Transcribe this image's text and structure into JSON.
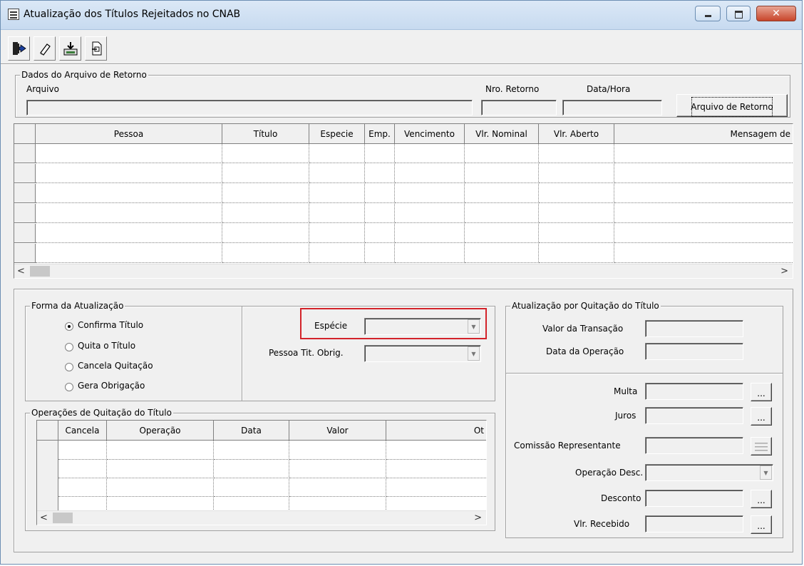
{
  "window": {
    "title": "Atualização dos Títulos Rejeitados no CNAB",
    "close_glyph": "✕"
  },
  "toolbar": {
    "exit_icon": "exit-icon",
    "eraser_icon": "eraser-icon",
    "save_icon": "save-icon",
    "export_icon": "export-icon"
  },
  "retorno": {
    "legend": "Dados do Arquivo de Retorno",
    "arquivo_label": "Arquivo",
    "nro_label": "Nro. Retorno",
    "data_label": "Data/Hora",
    "button_label": "Arquivo de Retorno"
  },
  "main_grid": {
    "columns": [
      "Pessoa",
      "Título",
      "Especie",
      "Emp.",
      "Vencimento",
      "Vlr. Nominal",
      "Vlr. Aberto",
      "Mensagem de"
    ]
  },
  "forma": {
    "legend": "Forma da Atualização",
    "options": [
      "Confirma Título",
      "Quita o Título",
      "Cancela Quitação",
      "Gera Obrigação"
    ],
    "selected": "Confirma Título",
    "especie_label": "Espécie",
    "pessoa_label": "Pessoa Tit. Obrig."
  },
  "operacoes": {
    "legend": "Operações de Quitação do Título",
    "columns": [
      "Cancela",
      "Operação",
      "Data",
      "Valor",
      "Ot"
    ]
  },
  "quitacao": {
    "legend": "Atualização por Quitação do Título",
    "valor_label": "Valor da Transação",
    "data_label": "Data da Operação",
    "multa_label": "Multa",
    "juros_label": "Juros",
    "comissao_label": "Comissão Representante",
    "opdesc_label": "Operação Desc.",
    "desconto_label": "Desconto",
    "recebido_label": "Vlr. Recebido",
    "ellipsis": "..."
  },
  "scroll": {
    "left": "<",
    "right": ">"
  }
}
